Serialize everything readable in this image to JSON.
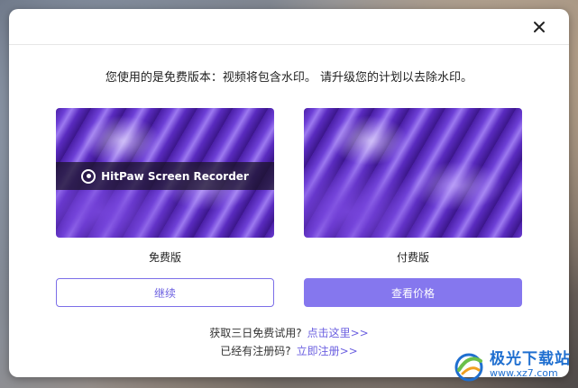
{
  "dialog": {
    "close_icon": "close-icon",
    "notice": "您使用的是免费版本：视频将包含水印。 请升级您的计划以去除水印。"
  },
  "free_plan": {
    "watermark_text": "HitPaw Screen Recorder",
    "label": "免费版",
    "button": "继续"
  },
  "paid_plan": {
    "label": "付费版",
    "button": "查看价格"
  },
  "links": {
    "trial_prompt": "获取三日免费试用?",
    "trial_link": "点击这里>>",
    "register_prompt": "已经有注册码?",
    "register_link": "立即注册>>"
  },
  "brand": {
    "cn": "极光下载站",
    "en": "www.xz7.com"
  },
  "colors": {
    "accent": "#8577ee",
    "link": "#6b5fe0"
  }
}
